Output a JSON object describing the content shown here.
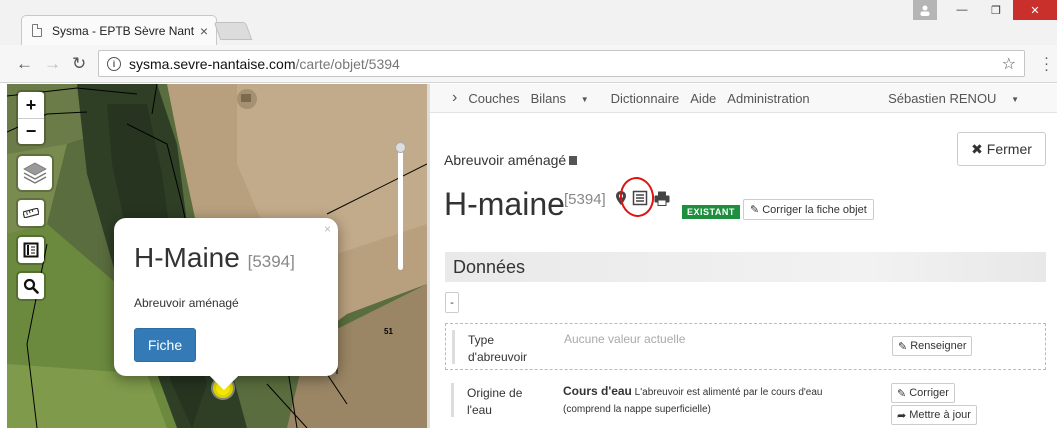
{
  "browser": {
    "tab_title": "Sysma - EPTB Sèvre Nant",
    "tab_close": "×",
    "url_host": "sysma.sevre-nantaise.com",
    "url_path": "/carte/objet/5394",
    "back": "←",
    "forward": "→",
    "reload": "↻",
    "star": "☆",
    "win_minimize": "—",
    "win_restore": "❐",
    "win_close": "✕"
  },
  "map": {
    "zoom_in": "+",
    "zoom_out": "−",
    "parcel_label": "51",
    "popup": {
      "close": "×",
      "title": "H-Maine",
      "id": "[5394]",
      "type": "Abreuvoir aménagé",
      "button": "Fiche"
    }
  },
  "nav": {
    "caret": "›",
    "items": [
      "Couches",
      "Bilans",
      "Dictionnaire",
      "Aide",
      "Administration"
    ],
    "user": "Sébastien RENOU"
  },
  "object": {
    "close_label": "Fermer",
    "subtype": "Abreuvoir aménagé",
    "title": "H-maine",
    "id": "[5394]",
    "status": "EXISTANT",
    "edit_label": "Corriger la fiche objet"
  },
  "data_section": {
    "title": "Données",
    "collapse": "-",
    "rows": [
      {
        "label": "Type d'abreuvoir",
        "value": "Aucune valeur actuelle",
        "button": "Renseigner"
      },
      {
        "label": "Origine de l'eau",
        "value_bold": "Cours d'eau",
        "value": "L'abreuvoir est alimenté par le cours d'eau (comprend la nappe superficielle)",
        "button": "Corriger",
        "button2": "Mettre à jour"
      }
    ]
  },
  "colors": {
    "status_green": "#1e8f3e",
    "primary_blue": "#337ab7",
    "annotation_red": "#e01212"
  }
}
